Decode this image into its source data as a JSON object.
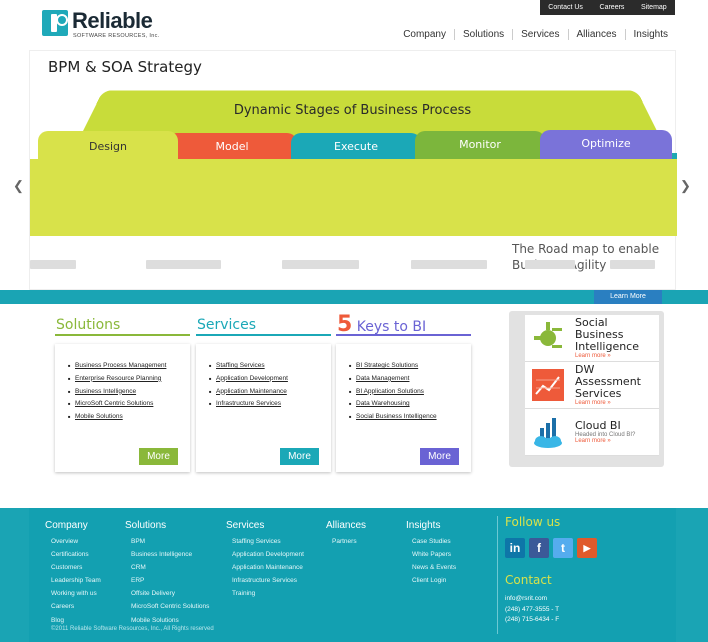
{
  "utility": [
    "Contact Us",
    "Careers",
    "Sitemap"
  ],
  "logo": {
    "name": "Reliable",
    "sub": "SOFTWARE RESOURCES, Inc."
  },
  "nav": [
    "Company",
    "Solutions",
    "Services",
    "Alliances",
    "Insights"
  ],
  "hero": {
    "title": "BPM & SOA Strategy",
    "stages_title": "Dynamic Stages of Business Process",
    "tabs": [
      "Design",
      "Model",
      "Execute",
      "Monitor",
      "Optimize"
    ],
    "roadmap_line1": "The Road map to enable",
    "roadmap_line2": "Business Agility",
    "arrow_left": "❮",
    "arrow_right": "❯",
    "learn_more": "Learn More"
  },
  "columns": {
    "solutions": {
      "title": "Solutions",
      "items": [
        "Business Process Management",
        "Enterprise Resource Planning",
        "Business Intelligence",
        "MicroSoft Centric Solutions",
        "Mobile Solutions"
      ],
      "more": "More"
    },
    "services": {
      "title": "Services",
      "items": [
        "Staffing Services",
        "Application Development",
        "Application Maintenance",
        "Infrastructure Services"
      ],
      "more": "More"
    },
    "keys": {
      "number": "5",
      "title": "Keys to BI",
      "items": [
        "BI Strategic Solutions",
        "Data Management",
        "BI Application Solutions",
        "Data Warehousing",
        "Social Business Intelligence"
      ],
      "more": "More"
    }
  },
  "promo": [
    {
      "title1": "Social Business",
      "title2": "Intelligence",
      "sub": "",
      "link": "Learn more »",
      "icon": "social-bi-icon"
    },
    {
      "title1": "DW Assessment",
      "title2": "Services",
      "sub": "",
      "link": "Learn more »",
      "icon": "dw-chart-icon"
    },
    {
      "title1": "Cloud BI",
      "title2": "",
      "sub": "Headed into Cloud BI?",
      "link": "Learn more »",
      "icon": "cloud-bi-icon"
    }
  ],
  "footer": {
    "company": {
      "title": "Company",
      "items": [
        "Overview",
        "Certifications",
        "Customers",
        "Leadership Team",
        "Working with us",
        "Careers",
        "Blog"
      ]
    },
    "solutions": {
      "title": "Solutions",
      "items": [
        "BPM",
        "Business Intelligence",
        "CRM",
        "ERP",
        "Offsite Delivery",
        "MicroSoft Centric Solutions",
        "Mobile Solutions"
      ]
    },
    "services": {
      "title": "Services",
      "items": [
        "Staffing Services",
        "Application Development",
        "Application Maintenance",
        "Infrastructure Services",
        "Training"
      ]
    },
    "alliances": {
      "title": "Alliances",
      "items": [
        "Partners"
      ]
    },
    "insights": {
      "title": "Insights",
      "items": [
        "Case Studies",
        "White Papers",
        "News & Events",
        "Client Login"
      ]
    },
    "follow_us": "Follow us",
    "social": [
      {
        "label": "in",
        "color": "#0e76a8",
        "icon": "linkedin-icon"
      },
      {
        "label": "f",
        "color": "#3b5998",
        "icon": "facebook-icon"
      },
      {
        "label": "t",
        "color": "#55acee",
        "icon": "twitter-icon"
      },
      {
        "label": "▶",
        "color": "#e05a2b",
        "icon": "blogger-icon"
      }
    ],
    "contact": "Contact",
    "email": "info@rsrit.com",
    "phone_t": "(248) 477-3555 - T",
    "phone_f": "(248) 715-6434 - F",
    "copyright": "©2011 Reliable Software Resources, Inc., All Rights reserved"
  }
}
